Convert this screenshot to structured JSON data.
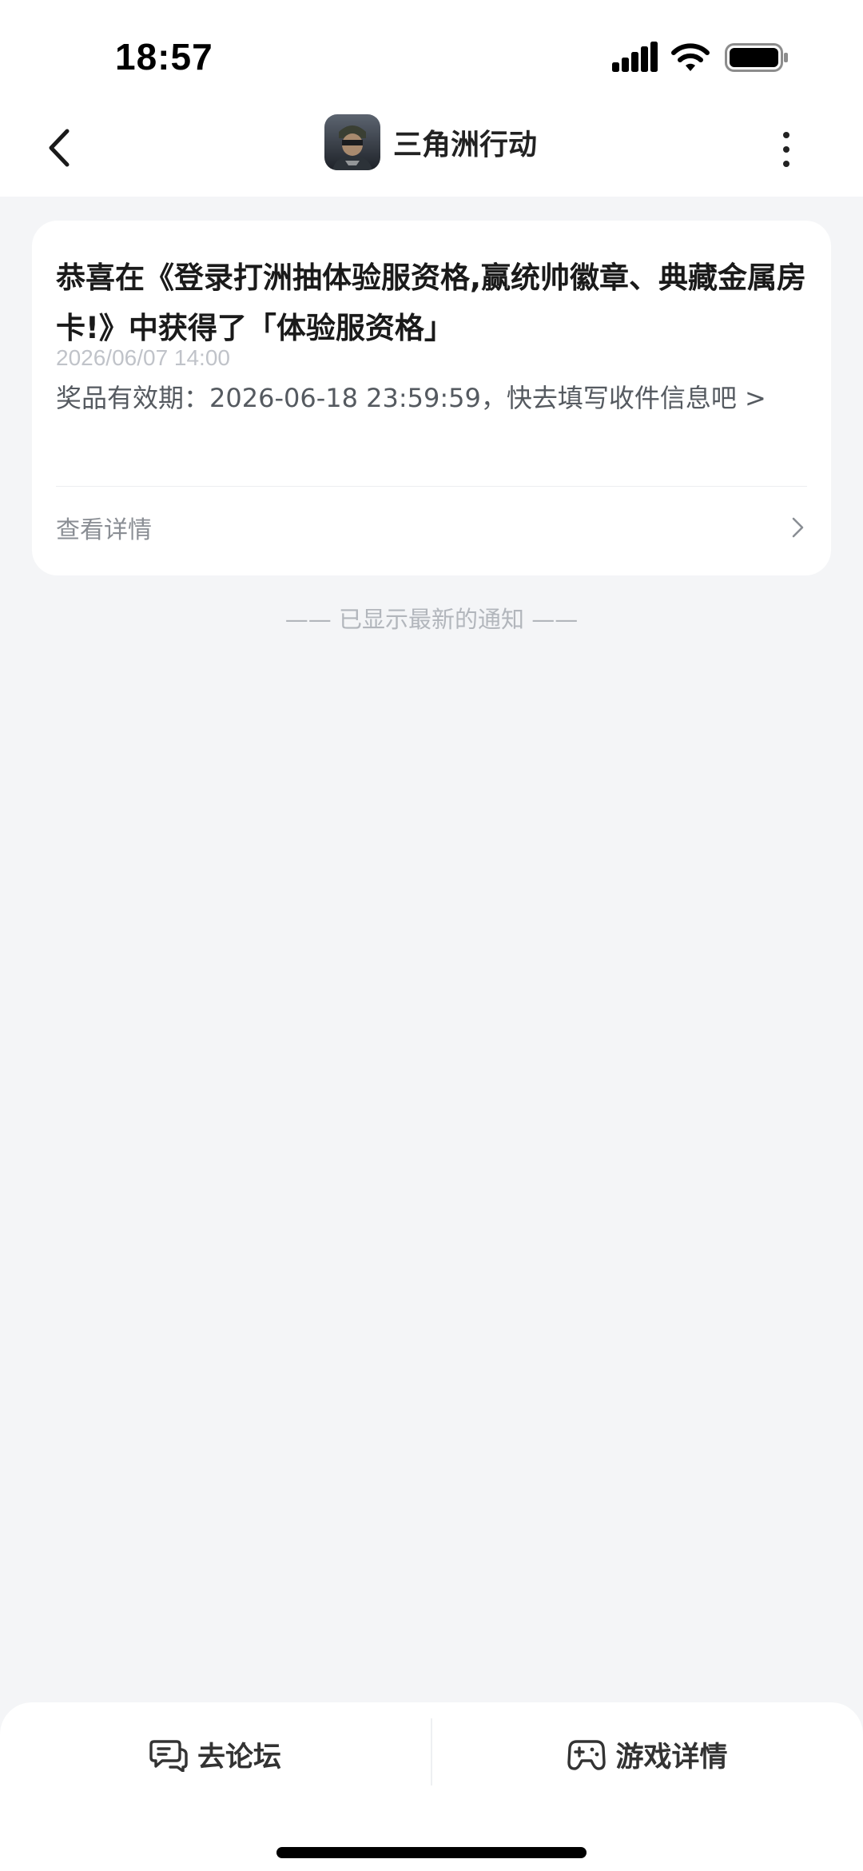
{
  "status_bar": {
    "time": "18:57"
  },
  "header": {
    "title": "三角洲行动",
    "back_icon": "chevron-left-icon",
    "more_icon": "more-vertical-icon"
  },
  "notification": {
    "title": "恭喜在《登录打洲抽体验服资格,赢统帅徽章、典藏金属房卡!》中获得了「体验服资格」",
    "date": "2026/06/07 14:00",
    "description": "奖品有效期：2026-06-18 23:59:59，快去填写收件信息吧 >",
    "detail_label": "查看详情"
  },
  "latest_note": "—— 已显示最新的通知 ——",
  "bottom_bar": {
    "forum_label": "去论坛",
    "game_label": "游戏详情"
  },
  "colors": {
    "page_background": "#f4f5f7",
    "card_background": "#ffffff",
    "muted_text": "#b2b6bc"
  }
}
